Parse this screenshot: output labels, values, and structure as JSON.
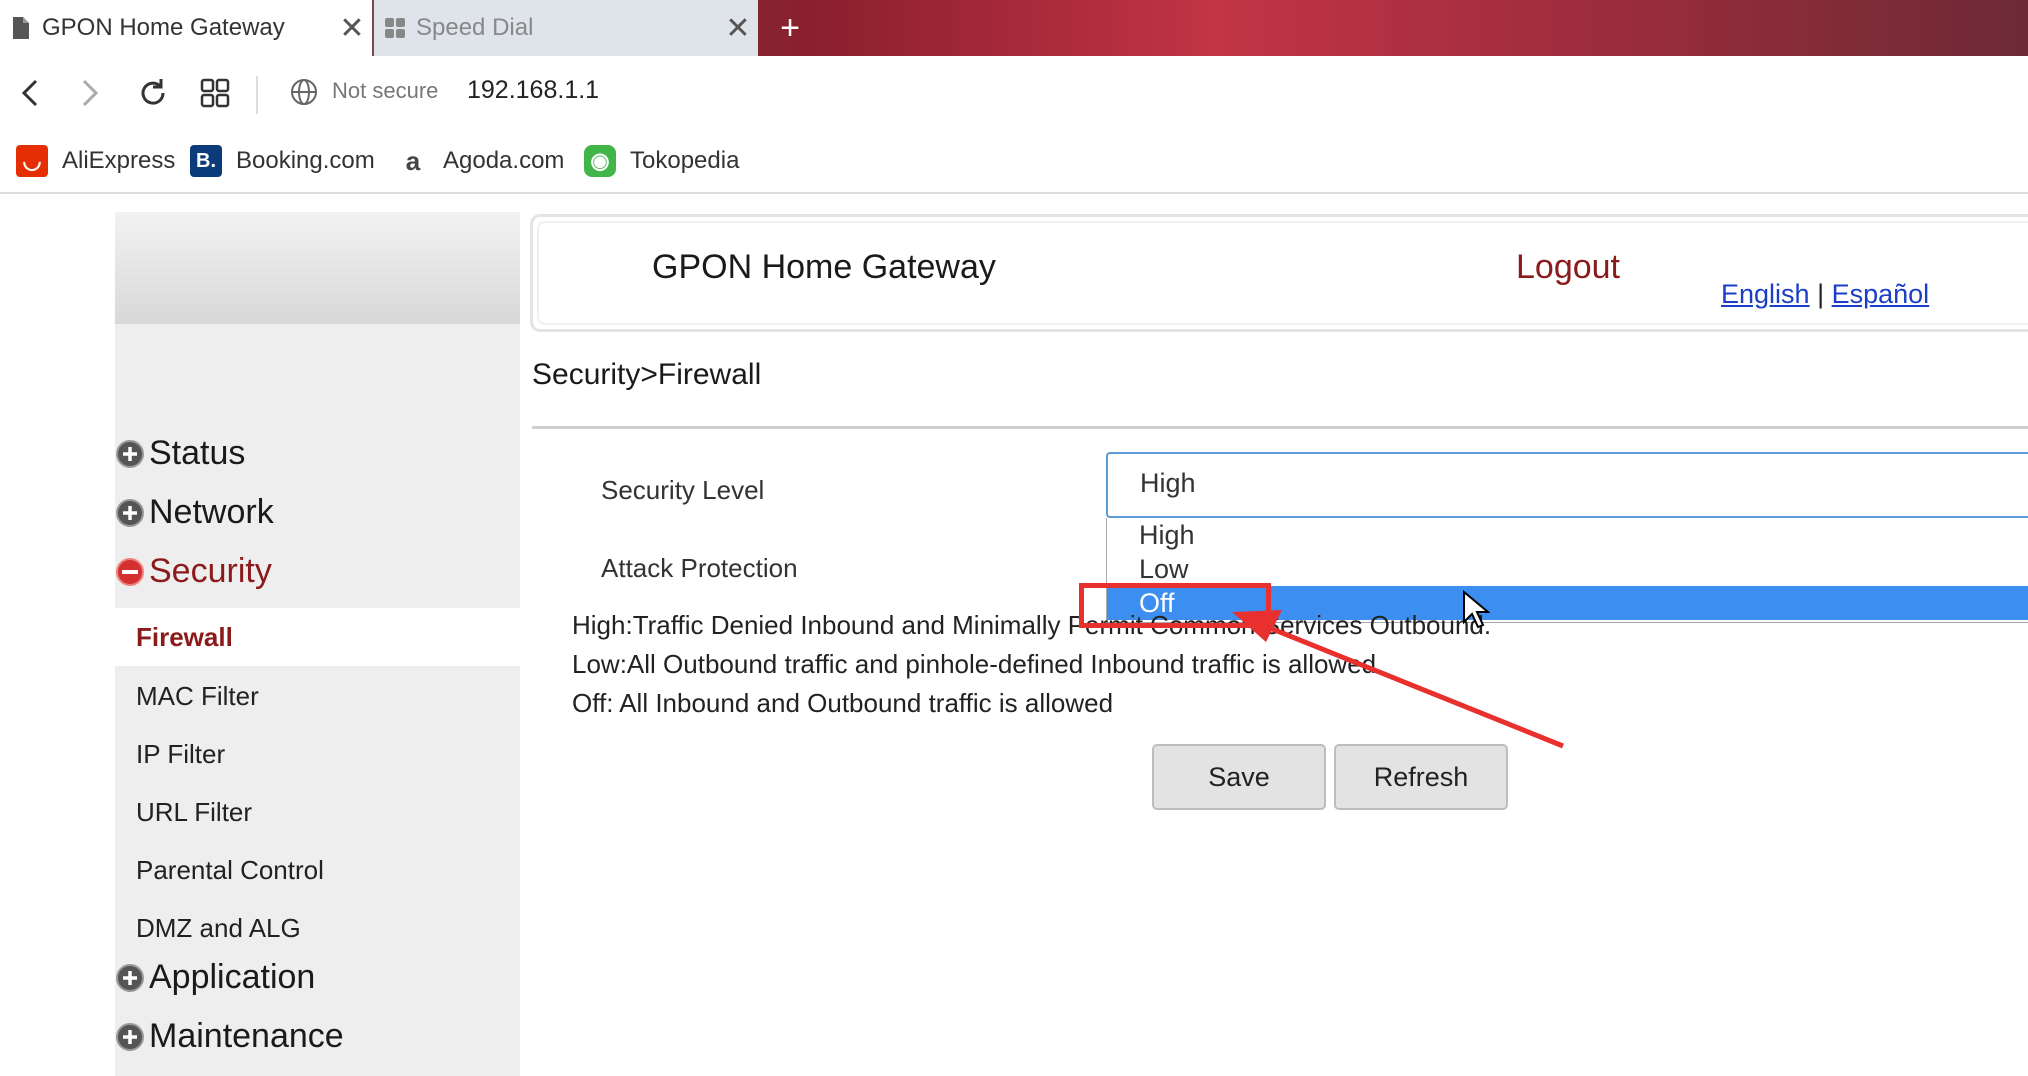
{
  "browser": {
    "tabs": [
      {
        "title": "GPON Home Gateway",
        "active": true
      },
      {
        "title": "Speed Dial",
        "active": false
      }
    ],
    "security_label": "Not secure",
    "url": "192.168.1.1",
    "bookmarks": [
      {
        "label": "AliExpress",
        "color": "#e62e04",
        "glyph": "◡"
      },
      {
        "label": "Booking.com",
        "color": "#0c3b7c",
        "glyph": "B."
      },
      {
        "label": "Agoda.com",
        "color": "#ffffff",
        "glyph": "a"
      },
      {
        "label": "Tokopedia",
        "color": "#42b549",
        "glyph": "◉"
      }
    ]
  },
  "sidebar": {
    "menus": [
      {
        "label": "Status",
        "state": "collapsed"
      },
      {
        "label": "Network",
        "state": "collapsed"
      },
      {
        "label": "Security",
        "state": "expanded"
      },
      {
        "label": "Application",
        "state": "collapsed"
      },
      {
        "label": "Maintenance",
        "state": "collapsed"
      }
    ],
    "security_items": [
      "Firewall",
      "MAC Filter",
      "IP Filter",
      "URL Filter",
      "Parental Control",
      "DMZ and ALG"
    ],
    "selected_item": "Firewall"
  },
  "header": {
    "title": "GPON Home Gateway",
    "logout": "Logout",
    "lang_en": "English",
    "lang_sep": "|",
    "lang_es": "Español"
  },
  "breadcrumb": "Security>Firewall",
  "form": {
    "security_level_label": "Security Level",
    "attack_protection_label": "Attack Protection",
    "security_level_value": "High",
    "options": [
      "High",
      "Low",
      "Off"
    ],
    "highlighted_option": "Off"
  },
  "descriptions": [
    "High:Traffic Denied Inbound and Minimally Permit Common Services Outbound.",
    "Low:All Outbound traffic and pinhole-defined Inbound traffic is allowed.",
    "Off: All Inbound and Outbound traffic is allowed"
  ],
  "buttons": {
    "save": "Save",
    "refresh": "Refresh"
  },
  "annotation": {
    "color": "#e8302e"
  }
}
